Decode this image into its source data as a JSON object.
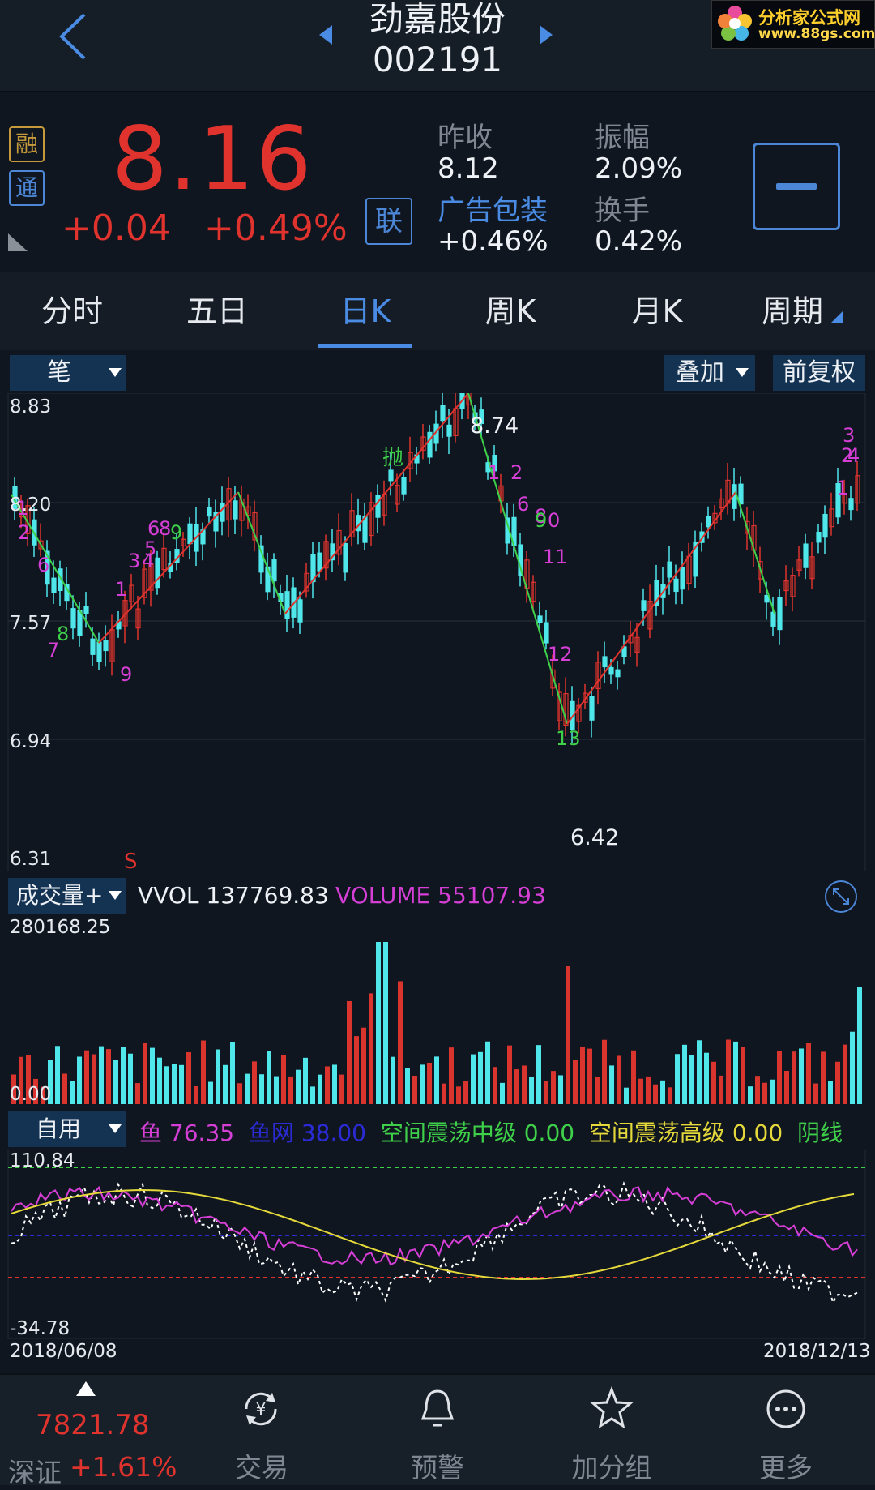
{
  "header": {
    "stock_name": "劲嘉股份",
    "stock_code": "002191"
  },
  "watermark": {
    "text": "分析家公式网",
    "url": "www.88gs.com"
  },
  "quote": {
    "tags": [
      "融",
      "通"
    ],
    "price": "8.16",
    "change": "+0.04",
    "change_pct": "+0.49%",
    "lian": "联",
    "prev_close_label": "昨收",
    "prev_close": "8.12",
    "amplitude_label": "振幅",
    "amplitude": "2.09%",
    "sector_label": "广告包装",
    "sector_change": "+0.46%",
    "turnover_label": "换手",
    "turnover": "0.42%"
  },
  "tabs": [
    "分时",
    "五日",
    "日K",
    "周K",
    "月K",
    "周期"
  ],
  "active_tab": 2,
  "kline": {
    "stroke_dropdown": "笔",
    "overlay_dropdown": "叠加",
    "adjust_button": "前复权",
    "y_ticks": [
      "8.83",
      "8.20",
      "7.57",
      "6.94",
      "6.31"
    ],
    "high_label": "8.74",
    "low_label": "6.42",
    "throw_label": "抛",
    "signal_s": "S"
  },
  "volume": {
    "dropdown": "成交量+",
    "vvol_label": "VVOL",
    "vvol_value": "137769.83",
    "volume_label": "VOLUME",
    "volume_value": "55107.93",
    "y_max": "280168.25",
    "y_min": "0.00"
  },
  "indicator": {
    "dropdown": "自用",
    "items": [
      {
        "name": "鱼",
        "value": "76.35",
        "color": "#d63fd6"
      },
      {
        "name": "鱼网",
        "value": "38.00",
        "color": "#2b2bd6"
      },
      {
        "name": "空间震荡中级",
        "value": "0.00",
        "color": "#3fd04a"
      },
      {
        "name": "空间震荡高级",
        "value": "0.00",
        "color": "#e4d83a"
      }
    ],
    "tail_label": "阴线",
    "y_max": "110.84",
    "y_min": "-34.78",
    "date_start": "2018/06/08",
    "date_end": "2018/12/13"
  },
  "nav": {
    "index_name": "深证",
    "index_value": "7821.78",
    "index_change": "+1.61%",
    "items": [
      "交易",
      "预警",
      "加分组",
      "更多"
    ]
  }
}
